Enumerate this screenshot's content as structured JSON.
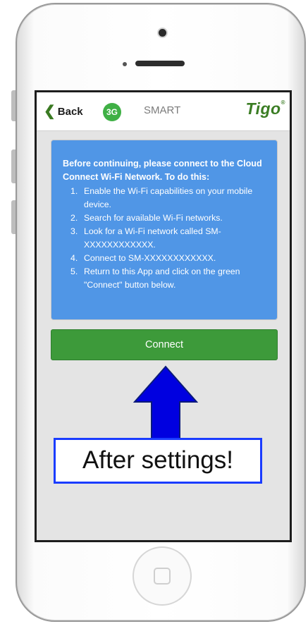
{
  "navbar": {
    "back_label": "Back",
    "chevron_glyph": "❮",
    "network_badge": "3G",
    "title": "SMART",
    "logo_text": "Tigo",
    "logo_mark": "®"
  },
  "instructions": {
    "intro": "Before continuing, please connect to the Cloud Connect Wi-Fi Network. To do this:",
    "steps": [
      {
        "num": "1.",
        "text": "Enable the Wi-Fi capabilities on your mobile device."
      },
      {
        "num": "2.",
        "text": "Search for available Wi-Fi networks."
      },
      {
        "num": "3.",
        "text": "Look for a Wi-Fi network called SM-XXXXXXXXXXXX."
      },
      {
        "num": "4.",
        "text": "Connect to SM-XXXXXXXXXXXX."
      },
      {
        "num": "5.",
        "text": "Return to this App and click on the green \"Connect\" button below."
      }
    ]
  },
  "connect_button": {
    "label": "Connect"
  },
  "annotation": {
    "text": "After settings!"
  },
  "colors": {
    "info_box": "#5096e6",
    "connect_button": "#3d9a3a",
    "badge": "#3fb045",
    "arrow_fill": "#0000e0",
    "callout_border": "#1a3cff"
  }
}
